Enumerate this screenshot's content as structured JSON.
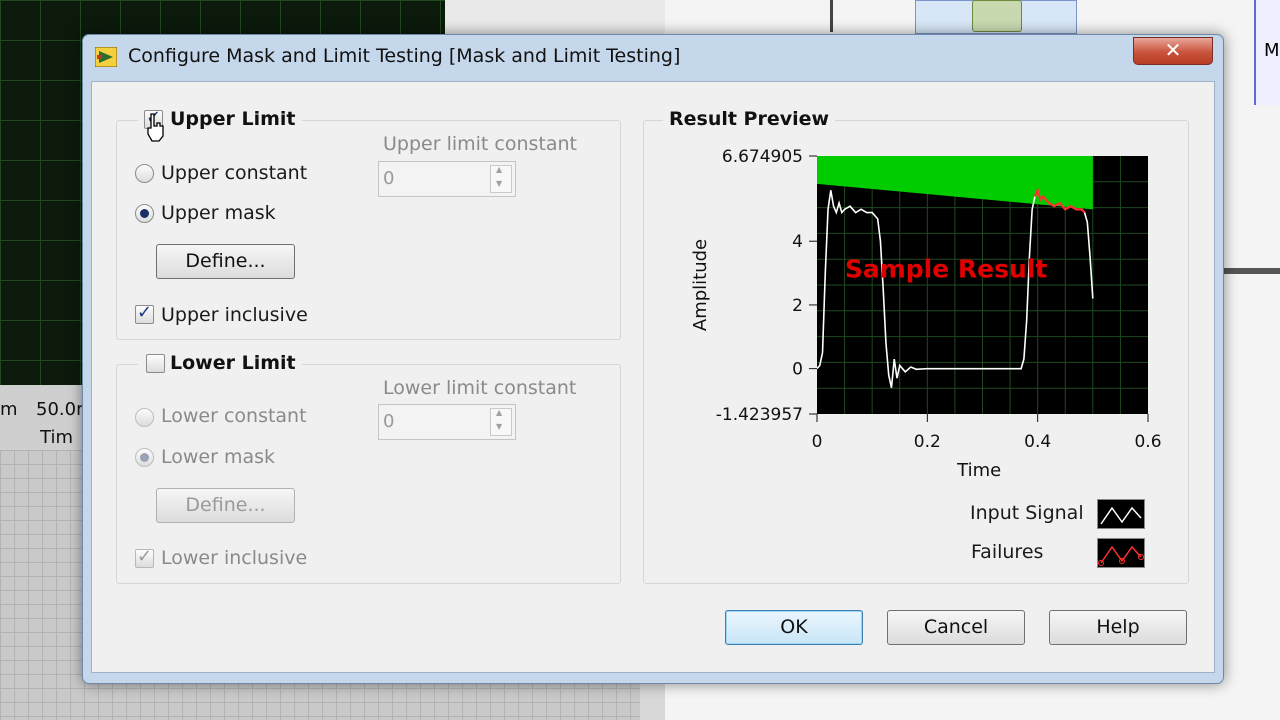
{
  "background": {
    "left_value": "50.0r",
    "left_prefix": "m",
    "left_axis": "Tim",
    "right_edge": "M"
  },
  "dialog": {
    "title": "Configure Mask and Limit Testing [Mask and Limit Testing]",
    "close_label": "✕"
  },
  "upper_limit": {
    "title": "Upper Limit",
    "enabled": true,
    "constant_label": "Upper constant",
    "mask_label": "Upper mask",
    "selected": "mask",
    "define_label": "Define...",
    "inclusive_label": "Upper inclusive",
    "inclusive_checked": true,
    "constant_field_label": "Upper limit constant",
    "constant_value": "0"
  },
  "lower_limit": {
    "title": "Lower Limit",
    "enabled": false,
    "constant_label": "Lower constant",
    "mask_label": "Lower mask",
    "selected": "mask",
    "define_label": "Define...",
    "inclusive_label": "Lower inclusive",
    "inclusive_checked": true,
    "constant_field_label": "Lower limit constant",
    "constant_value": "0"
  },
  "preview": {
    "title": "Result Preview",
    "overlay_text": "Sample Result",
    "legend": [
      {
        "label": "Input Signal",
        "icon": "input-signal-swatch-icon"
      },
      {
        "label": "Failures",
        "icon": "failures-swatch-icon"
      }
    ]
  },
  "buttons": {
    "ok": "OK",
    "cancel": "Cancel",
    "help": "Help"
  },
  "colors": {
    "mask_fill": "#00cc00",
    "signal": "#ffffff",
    "failure": "#ff3030",
    "overlay_text": "#e00000"
  },
  "chart_data": {
    "type": "line",
    "xlabel": "Time",
    "ylabel": "Amplitude",
    "xlim": [
      0,
      0.6
    ],
    "ylim": [
      -1.423957,
      6.674905
    ],
    "x_ticks": [
      "0",
      "0.2",
      "0.4",
      "0.6"
    ],
    "y_ticks": [
      "6.674905",
      "4",
      "2",
      "0",
      "-1.423957"
    ],
    "upper_mask": {
      "x": [
        0,
        0.5
      ],
      "y": [
        5.8,
        5.0
      ]
    },
    "series": [
      {
        "name": "Input Signal",
        "x": [
          0,
          0.005,
          0.01,
          0.015,
          0.02,
          0.025,
          0.03,
          0.035,
          0.04,
          0.045,
          0.05,
          0.06,
          0.07,
          0.08,
          0.09,
          0.1,
          0.11,
          0.115,
          0.12,
          0.125,
          0.13,
          0.135,
          0.14,
          0.145,
          0.15,
          0.16,
          0.17,
          0.18,
          0.2,
          0.25,
          0.3,
          0.35,
          0.37,
          0.375,
          0.38,
          0.385,
          0.39,
          0.395,
          0.4,
          0.405,
          0.41,
          0.42,
          0.43,
          0.44,
          0.45,
          0.46,
          0.47,
          0.48,
          0.485,
          0.49,
          0.495,
          0.5
        ],
        "y": [
          0,
          0.1,
          0.5,
          3.0,
          5.0,
          5.6,
          5.1,
          4.9,
          5.2,
          4.9,
          5.0,
          5.1,
          4.9,
          5.0,
          4.9,
          4.9,
          4.7,
          4.0,
          2.5,
          0.8,
          -0.2,
          -0.6,
          0.3,
          -0.3,
          0.1,
          -0.1,
          0.05,
          -0.02,
          0,
          0,
          0,
          0,
          0,
          0.3,
          1.5,
          3.5,
          5.0,
          5.4,
          5.6,
          5.3,
          5.4,
          5.2,
          5.1,
          5.2,
          5.0,
          5.1,
          5.0,
          5.0,
          4.9,
          4.6,
          3.5,
          2.2
        ]
      },
      {
        "name": "Failures",
        "x": [
          0.395,
          0.4,
          0.405,
          0.41,
          0.42,
          0.43,
          0.44,
          0.45,
          0.46,
          0.47,
          0.48,
          0.485
        ],
        "y": [
          5.4,
          5.6,
          5.3,
          5.4,
          5.2,
          5.1,
          5.2,
          5.0,
          5.1,
          5.0,
          5.0,
          4.9
        ]
      }
    ]
  }
}
